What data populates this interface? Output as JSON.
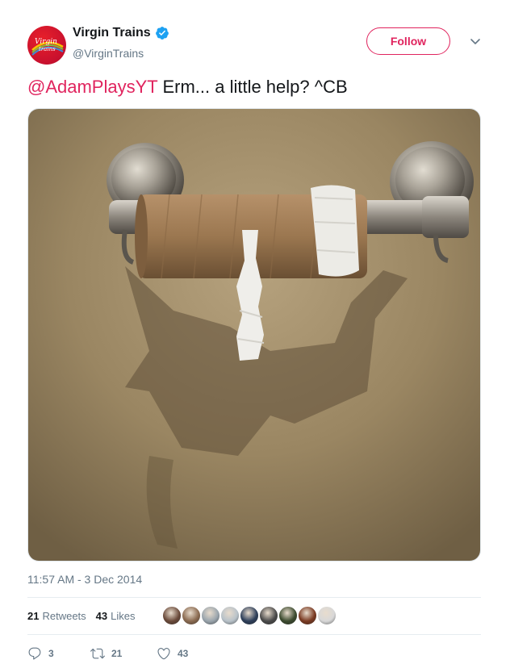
{
  "account": {
    "name": "Virgin Trains",
    "handle": "@VirginTrains",
    "avatar_text_top": "Virgin",
    "avatar_text_bottom": "trains",
    "follow_label": "Follow",
    "brand_color": "#e0245e"
  },
  "tweet": {
    "mention": "@AdamPlaysYT",
    "text": " Erm... a little help? ^CB",
    "timestamp": "11:57 AM - 3 Dec 2014"
  },
  "stats": {
    "retweets_count": "21",
    "retweets_label": "Retweets",
    "likes_count": "43",
    "likes_label": "Likes"
  },
  "likers": [
    "#6a4a3a",
    "#8a6a50",
    "#9aa5ad",
    "#b8c2c9",
    "#2e3f5a",
    "#4a4a4a",
    "#3b4a2e",
    "#7a3a22",
    "#d8d8d8"
  ],
  "actions": {
    "reply_count": "3",
    "retweet_count": "21",
    "like_count": "43"
  },
  "icons": [
    "verified-badge-icon",
    "chevron-down-icon",
    "reply-icon",
    "retweet-icon",
    "heart-icon"
  ]
}
